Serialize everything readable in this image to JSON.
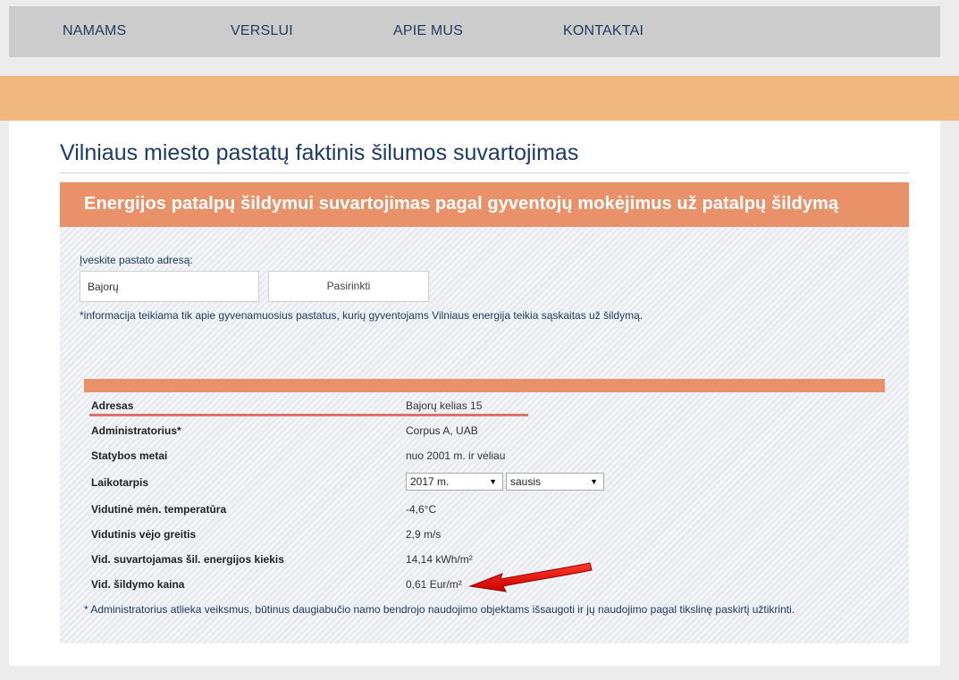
{
  "nav": {
    "items": [
      "NAMAMS",
      "VERSLUI",
      "APIE MUS",
      "KONTAKTAI"
    ]
  },
  "page": {
    "title": "Vilniaus miesto pastatų faktinis šilumos suvartojimas"
  },
  "section": {
    "header": "Energijos patalpų šildymui suvartojimas pagal gyventojų mokėjimus už patalpų šildymą",
    "address_label": "Įveskite pastato adresą:",
    "address_value": "Bajorų",
    "select_button": "Pasirinkti",
    "info_note": "*informacija teikiama tik apie gyvenamuosius pastatus, kurių gyventojams Vilniaus energija teikia sąskaitas už šildymą."
  },
  "table": {
    "rows": [
      {
        "label": "Adresas",
        "value": "Bajorų kelias 15"
      },
      {
        "label": "Administratorius*",
        "value": "Corpus A, UAB"
      },
      {
        "label": "Statybos metai",
        "value": "nuo 2001 m. ir vėliau"
      },
      {
        "label": "Laikotarpis",
        "value": ""
      },
      {
        "label": "Vidutinė mėn. temperatūra",
        "value": "-4,6°C"
      },
      {
        "label": "Vidutinis vėjo greitis",
        "value": "2,9 m/s"
      },
      {
        "label": "Vid. suvartojamas šil. energijos kiekis",
        "value": "14,14 kWh/m²"
      },
      {
        "label": "Vid. šildymo kaina",
        "value": "0,61 Eur/m²"
      }
    ],
    "year_select": "2017 m.",
    "month_select": "sausis",
    "footnote": "* Administratorius atlieka veiksmus, būtinus daugiabučio namo bendrojo naudojimo objektams išsaugoti ir jų naudojimo pagal tikslinę paskirtį užtikrinti."
  },
  "colors": {
    "accent": "#e9926a",
    "banner": "#f0b77e",
    "title": "#1d3b64",
    "arrow": "#e01010"
  }
}
